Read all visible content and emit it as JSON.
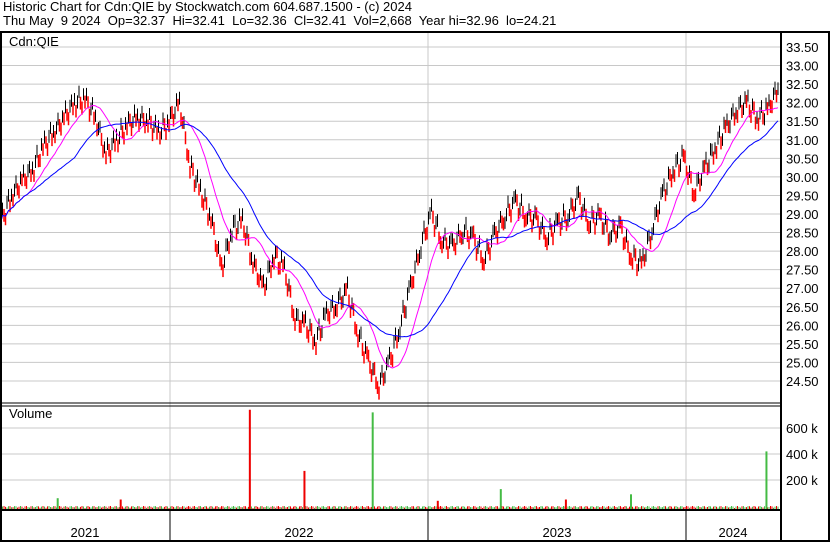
{
  "header": {
    "title": "Historic Chart for Cdn:QIE by Stockwatch.com 604.687.1500 - (c) 2024",
    "quote": "Thu May  9 2024  Op=32.37  Hi=32.41  Lo=32.36  Cl=32.41  Vol=2,668  Year hi=32.96  lo=24.21"
  },
  "chart_data": {
    "type": "line",
    "title": "Cdn:QIE",
    "symbol": "Cdn:QIE",
    "x_frequency": "semi-monthly, starting May 2021",
    "closes": [
      28.8,
      29.5,
      29.9,
      30.2,
      30.8,
      31.2,
      31.6,
      32.0,
      32.1,
      31.6,
      30.6,
      31.0,
      31.4,
      31.6,
      31.5,
      31.2,
      31.5,
      32.0,
      30.3,
      29.6,
      28.9,
      27.5,
      28.6,
      28.8,
      27.7,
      27.0,
      27.9,
      27.5,
      26.2,
      26.0,
      25.6,
      26.3,
      26.6,
      26.9,
      25.8,
      25.0,
      24.4,
      25.0,
      26.0,
      27.0,
      28.2,
      29.0,
      28.3,
      28.1,
      28.6,
      28.3,
      27.8,
      28.4,
      29.0,
      29.3,
      29.0,
      28.8,
      28.4,
      28.7,
      29.0,
      29.4,
      28.8,
      28.9,
      28.5,
      28.6,
      27.9,
      27.6,
      28.6,
      29.5,
      30.2,
      30.5,
      29.6,
      30.2,
      30.8,
      31.3,
      31.8,
      32.0,
      31.6,
      31.8,
      32.4
    ],
    "moving_averages": [
      {
        "name": "short MA",
        "color": "#ff00ff"
      },
      {
        "name": "long MA",
        "color": "#0000ff"
      }
    ],
    "y_ticks": [
      "33.50",
      "33.00",
      "32.50",
      "32.00",
      "31.50",
      "31.00",
      "30.50",
      "30.00",
      "29.50",
      "29.00",
      "28.50",
      "28.00",
      "27.50",
      "27.00",
      "26.50",
      "26.00",
      "25.50",
      "25.00",
      "24.50"
    ],
    "ylim": [
      24.21,
      33.5
    ],
    "volume": {
      "label": "Volume",
      "ticks": [
        "600 k",
        "400 k",
        "200 k"
      ],
      "spikes": [
        {
          "index": 5.4,
          "value": 60000,
          "dir": "up"
        },
        {
          "index": 11.4,
          "value": 50000,
          "dir": "down"
        },
        {
          "index": 23.7,
          "value": 740000,
          "dir": "down"
        },
        {
          "index": 28.9,
          "value": 270000,
          "dir": "down"
        },
        {
          "index": 35.4,
          "value": 720000,
          "dir": "up"
        },
        {
          "index": 41.6,
          "value": 40000,
          "dir": "down"
        },
        {
          "index": 47.6,
          "value": 130000,
          "dir": "up"
        },
        {
          "index": 53.8,
          "value": 50000,
          "dir": "down"
        },
        {
          "index": 60.0,
          "value": 90000,
          "dir": "up"
        },
        {
          "index": 72.9,
          "value": 420000,
          "dir": "up"
        }
      ]
    },
    "x_labels": [
      "2021",
      "2022",
      "2023",
      "2024"
    ]
  },
  "colors": {
    "up": "#000000",
    "down": "#ff0000",
    "vol_up": "#44bb44",
    "vol_down": "#ee0000",
    "grid": "#c8c8c8"
  }
}
